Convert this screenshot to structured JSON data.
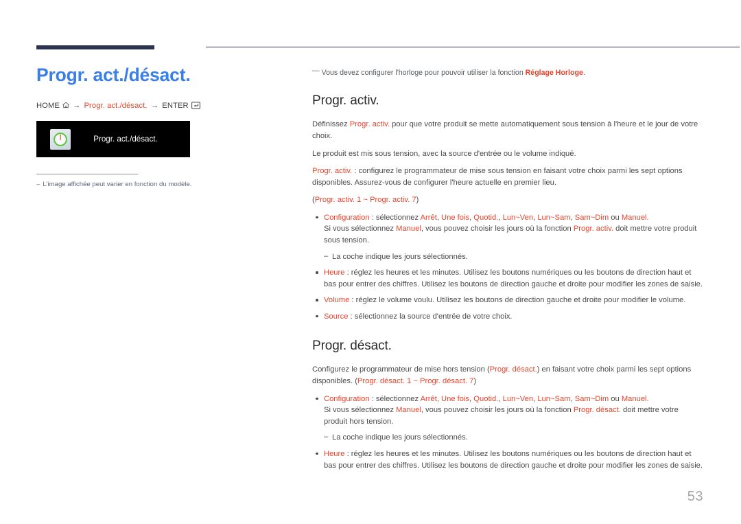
{
  "header": {
    "rule_color": "#2e3352"
  },
  "left": {
    "page_title": "Progr. act./désact.",
    "breadcrumb": {
      "home_label": "HOME",
      "home_icon": "home-icon",
      "arrow1": "→",
      "middle_label": "Progr. act./désact.",
      "arrow2": "→",
      "enter_label": "ENTER",
      "enter_icon": "enter-key-icon"
    },
    "menu_preview": {
      "icon": "power-toggle-icon",
      "label": "Progr. act./désact.",
      "background": "#000000"
    },
    "footnote": {
      "dash": "–",
      "text": "L'image affichée peut varier en fonction du modèle."
    }
  },
  "right": {
    "top_note": {
      "dash": "—",
      "text_before": "Vous devez configurer l'horloge pour pouvoir utiliser la fonction ",
      "highlight": "Réglage Horloge",
      "text_after": "."
    },
    "section1": {
      "title": "Progr. activ.",
      "para1_a": "Définissez ",
      "para1_red": "Progr. activ.",
      "para1_b": " pour que votre produit se mette automatiquement sous tension à l'heure et le jour de votre choix.",
      "para2": "Le produit est mis sous tension, avec la source d'entrée ou le volume indiqué.",
      "para3_red": "Progr. activ.",
      "para3_b": " : configurez le programmateur de mise sous tension en faisant votre choix parmi les sept options disponibles. Assurez-vous de configurer l'heure actuelle en premier lieu.",
      "range_open": "(",
      "range_red1": "Progr. activ. 1",
      "range_tilde": " ~ ",
      "range_red2": "Progr. activ. 7",
      "range_close": ")",
      "bullets": [
        {
          "label": "Configuration",
          "text_a": " : sélectionnez ",
          "options": [
            "Arrêt",
            "Une fois",
            "Quotid.",
            "Lun~Ven",
            "Lun~Sam",
            "Sam~Dim"
          ],
          "conj": " ou ",
          "last_option": "Manuel.",
          "text_b": "Si vous sélectionnez ",
          "manual": "Manuel",
          "text_c": ", vous pouvez choisir les jours où la fonction ",
          "func": "Progr. activ.",
          "text_d": " doit mettre votre produit sous tension."
        },
        {
          "label": "Heure",
          "text": " : réglez les heures et les minutes. Utilisez les boutons numériques ou les boutons de direction haut et bas pour entrer des chiffres. Utilisez les boutons de direction gauche et droite pour modifier les zones de saisie."
        },
        {
          "label": "Volume",
          "text": " : réglez le volume voulu. Utilisez les boutons de direction gauche et droite pour modifier le volume."
        },
        {
          "label": "Source",
          "text": " : sélectionnez la source d'entrée de votre choix."
        }
      ],
      "subnote": "La coche indique les jours sélectionnés."
    },
    "section2": {
      "title": "Progr. désact.",
      "para1_a": "Configurez le programmateur de mise hors tension (",
      "para1_red": "Progr. désact.",
      "para1_b": ") en faisant votre choix parmi les sept options disponibles. (",
      "range_red1": "Progr. désact. 1",
      "range_tilde": " ~ ",
      "range_red2": "Progr. désact. 7",
      "range_close": ")",
      "bullets": [
        {
          "label": "Configuration",
          "text_a": " : sélectionnez ",
          "options": [
            "Arrêt",
            "Une fois",
            "Quotid.",
            "Lun~Ven",
            "Lun~Sam",
            "Sam~Dim"
          ],
          "conj": " ou ",
          "last_option": "Manuel.",
          "text_b": "Si vous sélectionnez ",
          "manual": "Manuel",
          "text_c": ", vous pouvez choisir les jours où la fonction ",
          "func": "Progr. désact.",
          "text_d": " doit mettre votre produit hors tension."
        },
        {
          "label": "Heure",
          "text": " : réglez les heures et les minutes. Utilisez les boutons numériques ou les boutons de direction haut et bas pour entrer des chiffres. Utilisez les boutons de direction gauche et droite pour modifier les zones de saisie."
        }
      ],
      "subnote": "La coche indique les jours sélectionnés."
    }
  },
  "footer": {
    "page_number": "53"
  },
  "colors": {
    "accent_red": "#e8432a",
    "title_blue": "#3c7fe4",
    "navy": "#2e3352",
    "body_gray": "#4a4a4a"
  }
}
